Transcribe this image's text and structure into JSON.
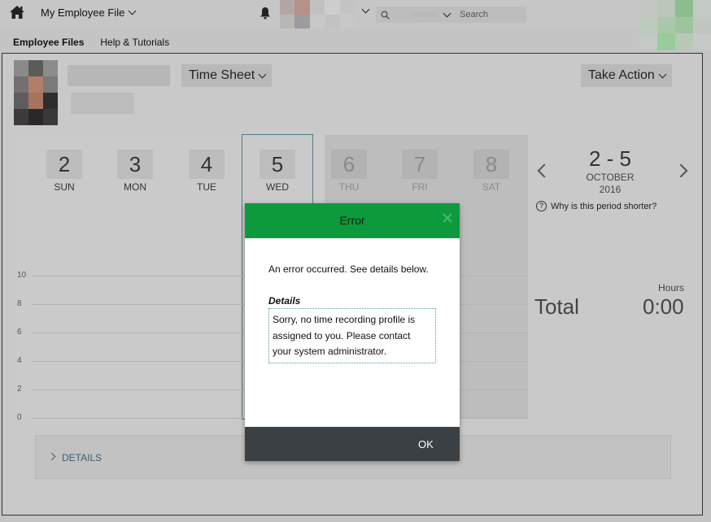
{
  "topbar": {
    "home_icon": "home-icon",
    "employee_file_label": "My Employee File",
    "bell_icon": "bell-icon",
    "search_filter": "People",
    "search_placeholder": "Search"
  },
  "nav": {
    "items": [
      {
        "label": "Employee Files",
        "active": true
      },
      {
        "label": "Help & Tutorials",
        "active": false
      }
    ]
  },
  "header": {
    "timesheet_label": "Time Sheet",
    "take_action_label": "Take Action"
  },
  "week": {
    "days": [
      {
        "num": "2",
        "name": "SUN",
        "dim": false
      },
      {
        "num": "3",
        "name": "MON",
        "dim": false
      },
      {
        "num": "4",
        "name": "TUE",
        "dim": false
      },
      {
        "num": "5",
        "name": "WED",
        "dim": false
      },
      {
        "num": "6",
        "name": "THU",
        "dim": true
      },
      {
        "num": "7",
        "name": "FRI",
        "dim": true
      },
      {
        "num": "8",
        "name": "SAT",
        "dim": true
      }
    ],
    "y_ticks": [
      "10",
      "8",
      "6",
      "4",
      "2",
      "0"
    ]
  },
  "period": {
    "range": "2 - 5",
    "month": "OCTOBER",
    "year": "2016",
    "why_text": "Why is this period shorter?",
    "hours_label": "Hours",
    "total_label": "Total",
    "total_value": "0:00"
  },
  "details": {
    "label": "DETAILS"
  },
  "modal": {
    "title": "Error",
    "message": "An error occurred. See details below.",
    "details_label": "Details",
    "details_text": "Sorry, no time recording profile is assigned to you. Please contact your system administrator.",
    "ok_label": "OK",
    "header_color": "#0c9a3c",
    "footer_color": "#3b4045"
  }
}
